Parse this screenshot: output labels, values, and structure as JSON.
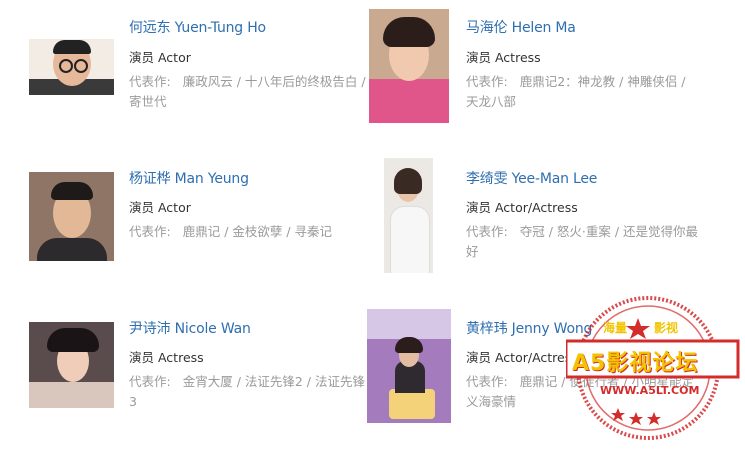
{
  "cast": [
    {
      "name": "何远东 Yuen-Tung Ho",
      "role": "演员 Actor",
      "works_label": "代表作:",
      "works": "廉政风云 / 十八年后的终极告白 / 寄世代"
    },
    {
      "name": "马海伦 Helen Ma",
      "role": "演员 Actress",
      "works_label": "代表作:",
      "works": "鹿鼎记2：神龙教 / 神雕侠侣 / 天龙八部"
    },
    {
      "name": "杨证桦 Man Yeung",
      "role": "演员 Actor",
      "works_label": "代表作:",
      "works": "鹿鼎记 / 金枝欲孽 / 寻秦记"
    },
    {
      "name": "李绮雯 Yee-Man Lee",
      "role": "演员 Actor/Actress",
      "works_label": "代表作:",
      "works": "夺冠 / 怒火·重案 / 还是觉得你最好"
    },
    {
      "name": "尹诗沛 Nicole Wan",
      "role": "演员 Actress",
      "works_label": "代表作:",
      "works": "金宵大厦 / 法证先锋2 / 法证先锋3"
    },
    {
      "name": "黄梓玮 Jenny Wong",
      "role": "演员 Actor/Actress",
      "works_label": "代表作:",
      "works": "鹿鼎记 / 使徒行者 / 小明星能定义海豪情"
    }
  ],
  "watermark": {
    "top": "海量",
    "top2": "影视",
    "brand": "A5影视论坛",
    "url": "WWW.A5LT.COM",
    "color": "#d42b2b",
    "accent": "#f2c400"
  },
  "photo_colors": [
    "#e9d5c0",
    "#d46a86",
    "#8a6a58",
    "#cfc6bd",
    "#6e5a57",
    "#a377b8"
  ]
}
